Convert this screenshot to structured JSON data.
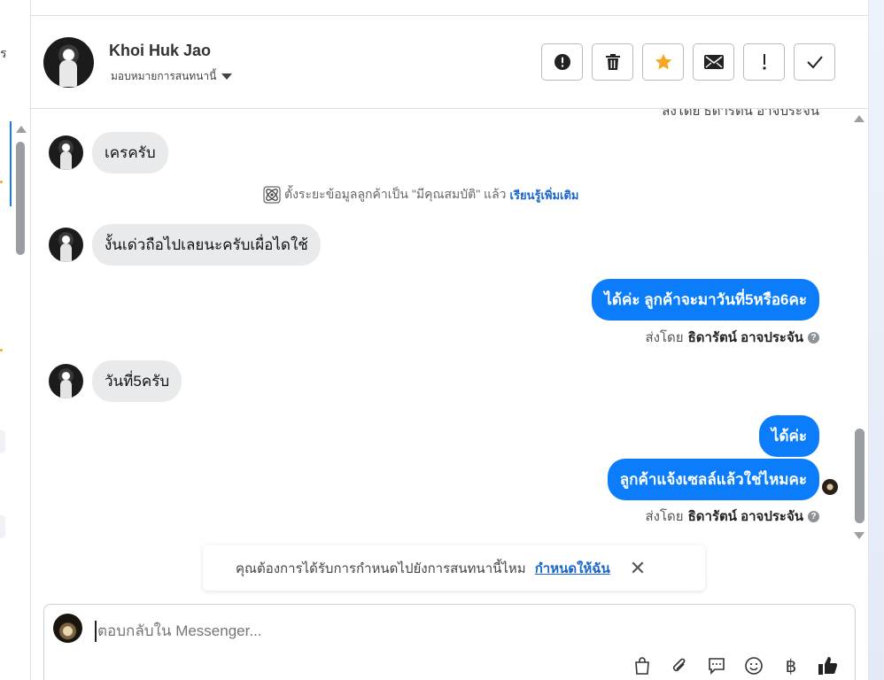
{
  "sidebar": {
    "cut_text": "ร"
  },
  "header": {
    "contact_name": "Khoi Huk Jao",
    "assign_label": "มอบหมายการสนทนานี้",
    "toolbar": [
      {
        "icon": "alert-circle-icon",
        "name": "mark-spam-button"
      },
      {
        "icon": "trash-icon",
        "name": "delete-button"
      },
      {
        "icon": "star-icon",
        "name": "star-button"
      },
      {
        "icon": "envelope-icon",
        "name": "mark-unread-button"
      },
      {
        "icon": "exclamation-icon",
        "name": "follow-up-button"
      },
      {
        "icon": "check-icon",
        "name": "done-button"
      }
    ],
    "star_color": "#f5a623"
  },
  "chat": {
    "cut_top_text": "ส่งโดย ธิดารัตน์ อาจประจัน",
    "messages": [
      {
        "direction": "in",
        "text": "เครครับ"
      },
      {
        "direction": "in",
        "text": "งั้นเด่วถือไปเลยนะครับเผื่อไดใช้"
      },
      {
        "direction": "out",
        "text": "ได้ค่ะ ลูกค้าจะมาวันที่5หรือ6คะ"
      },
      {
        "direction": "in",
        "text": "วันที่5ครับ"
      },
      {
        "direction": "out",
        "text": "ได้ค่ะ"
      },
      {
        "direction": "out",
        "text": "ลูกค้าแจ้งเซลล์แล้วใช่ไหมคะ"
      }
    ],
    "system_notice": {
      "text": "ตั้งระยะข้อมูลลูกค้าเป็น \"มีคุณสมบัติ\" แล้ว",
      "link": "เรียนรู้เพิ่มเติม"
    },
    "sent_by_prefix": "ส่งโดย",
    "sent_by_name": "ธิดารัตน์ อาจประจัน",
    "help_mark": "?",
    "outgoing_color": "#0b7dfa",
    "incoming_color": "#e9eaec"
  },
  "toast": {
    "text": "คุณต้องการได้รับการกำหนดไปยังการสนทนานี้ไหม",
    "link": "กำหนดให้ฉัน",
    "close": "✕"
  },
  "composer": {
    "placeholder": "ตอบกลับใน Messenger...",
    "icons": [
      "shopping-bag-icon",
      "paperclip-icon",
      "saved-reply-icon",
      "emoji-icon",
      "baht-icon",
      "thumbs-up-icon"
    ],
    "baht_symbol": "฿"
  }
}
